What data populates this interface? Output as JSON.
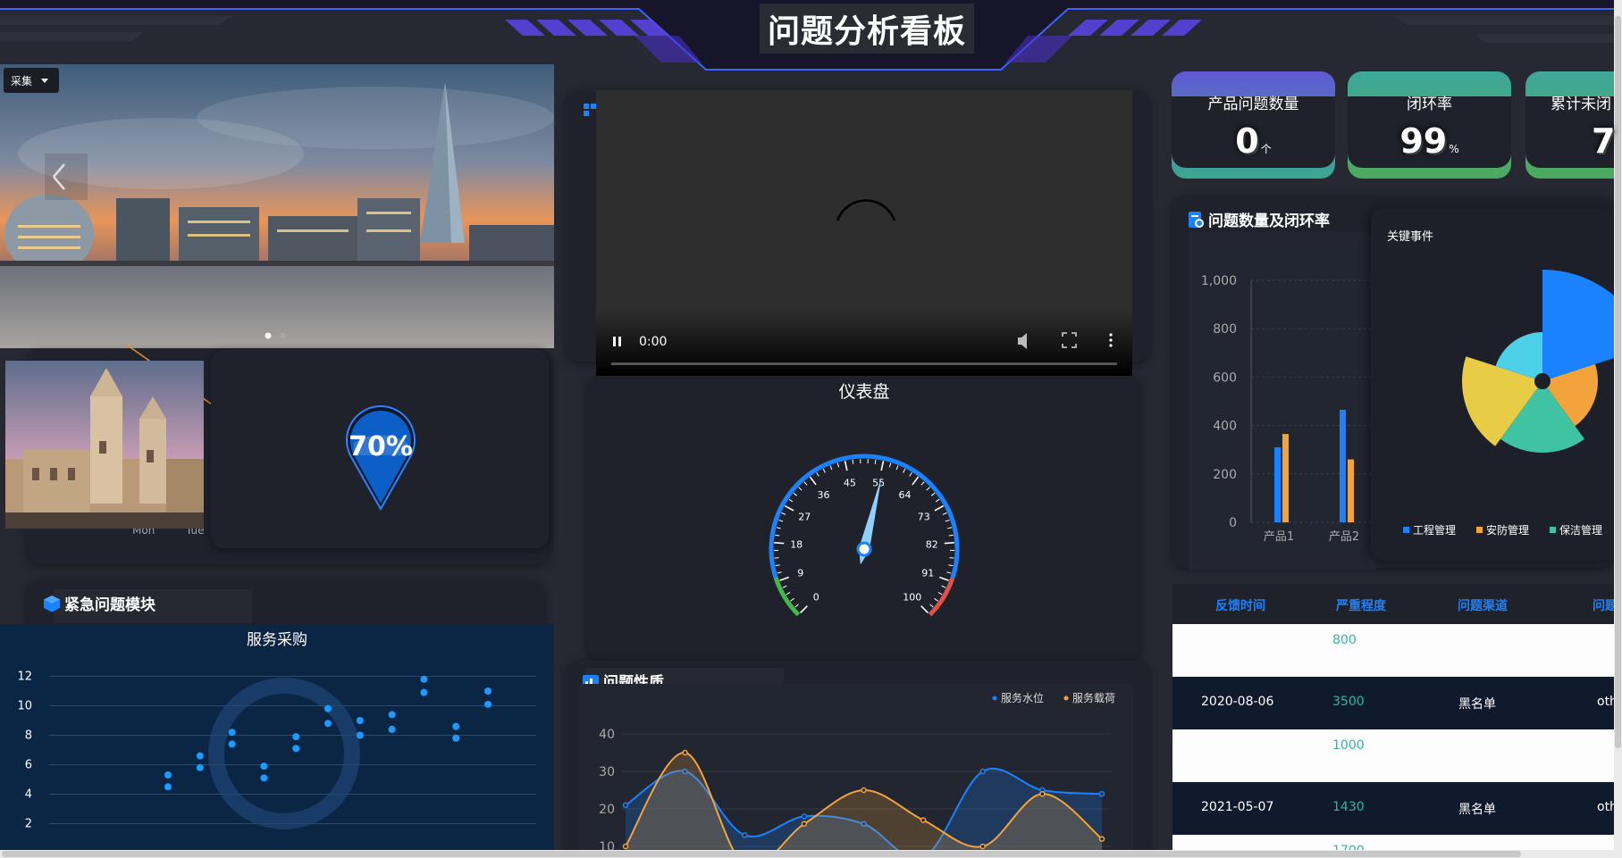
{
  "header": {
    "title": "问题分析看板"
  },
  "dropdown": {
    "label": "采集"
  },
  "video": {
    "time": "0:00"
  },
  "kpis": [
    {
      "label": "产品问题数量",
      "value": "0",
      "unit": "个"
    },
    {
      "label": "闭环率",
      "value": "99",
      "unit": "%"
    },
    {
      "label": "累计未闭",
      "value": "7",
      "unit": ""
    }
  ],
  "location_badge": {
    "value": "70%"
  },
  "small_chart": {
    "xlabels": [
      "Mon",
      "Tue"
    ]
  },
  "gauge": {
    "title": "仪表盘",
    "value": 55,
    "ticks": [
      "0",
      "9",
      "18",
      "27",
      "36",
      "45",
      "55",
      "64",
      "73",
      "82",
      "91",
      "100"
    ]
  },
  "sections": {
    "urgent": "紧急问题模块",
    "nature": "问题性质",
    "count_rate": "问题数量及闭环率"
  },
  "scatter": {
    "title": "服务采购",
    "chart_data": {
      "type": "scatter",
      "ylim": [
        1,
        13
      ],
      "yticks": [
        2,
        4,
        6,
        8,
        10,
        12
      ],
      "points": [
        [
          1,
          5.3
        ],
        [
          1,
          4.5
        ],
        [
          2,
          6.6
        ],
        [
          2,
          5.8
        ],
        [
          3,
          8.2
        ],
        [
          3,
          7.4
        ],
        [
          4,
          5.9
        ],
        [
          4,
          5.1
        ],
        [
          5,
          7.9
        ],
        [
          5,
          7.1
        ],
        [
          6,
          9.8
        ],
        [
          6,
          8.8
        ],
        [
          7,
          9.0
        ],
        [
          7,
          8.0
        ],
        [
          8,
          9.4
        ],
        [
          8,
          8.4
        ],
        [
          9,
          11.8
        ],
        [
          9,
          10.9
        ],
        [
          10,
          8.6
        ],
        [
          10,
          7.8
        ],
        [
          11,
          11.0
        ],
        [
          11,
          10.1
        ]
      ]
    }
  },
  "bar": {
    "chart_data": {
      "type": "bar",
      "categories": [
        "产品1",
        "产品2"
      ],
      "yticks": [
        "0",
        "200",
        "400",
        "600",
        "800",
        "1,000"
      ],
      "ylim": [
        0,
        1000
      ],
      "series": [
        {
          "values": [
            310,
            465
          ],
          "color": "#1a82ff"
        },
        {
          "values": [
            365,
            260
          ],
          "color": "#f3a33c"
        }
      ]
    }
  },
  "rose": {
    "title": "关键事件",
    "chart_data": {
      "type": "pie",
      "legend": [
        {
          "label": "工程管理",
          "color": "#1a82ff"
        },
        {
          "label": "安防管理",
          "color": "#f3a33c"
        },
        {
          "label": "保洁管理",
          "color": "#3fc3a2"
        }
      ],
      "slices": [
        {
          "value": 125,
          "color": "#1a82ff"
        },
        {
          "value": 62,
          "color": "#f3a33c"
        },
        {
          "value": 80,
          "color": "#3fc3a2"
        },
        {
          "value": 90,
          "color": "#e9cc45"
        },
        {
          "value": 55,
          "color": "#4cd0e8"
        }
      ]
    }
  },
  "line": {
    "chart_data": {
      "type": "area",
      "yticks": [
        10,
        20,
        30,
        40
      ],
      "ylim": [
        10,
        40
      ],
      "series": [
        {
          "name": "服务水位",
          "color": "#1a82ff",
          "values": [
            21,
            30,
            13,
            18,
            16,
            7,
            30,
            25,
            24
          ]
        },
        {
          "name": "服务载荷",
          "color": "#f3a33c",
          "values": [
            10,
            35,
            5,
            16,
            25,
            17,
            10,
            24,
            12
          ]
        }
      ]
    }
  },
  "table": {
    "headers": [
      "反馈时间",
      "严重程度",
      "问题渠道",
      "问题"
    ],
    "rows": [
      {
        "date": "",
        "severity": "800",
        "channel": "",
        "extra": "",
        "dark": false
      },
      {
        "date": "2020-08-06",
        "severity": "3500",
        "channel": "黑名单",
        "extra": "oth",
        "dark": true
      },
      {
        "date": "",
        "severity": "1000",
        "channel": "",
        "extra": "",
        "dark": false
      },
      {
        "date": "2021-05-07",
        "severity": "1430",
        "channel": "黑名单",
        "extra": "oth",
        "dark": true
      },
      {
        "date": "",
        "severity": "1700",
        "channel": "",
        "extra": "",
        "dark": false
      }
    ]
  }
}
